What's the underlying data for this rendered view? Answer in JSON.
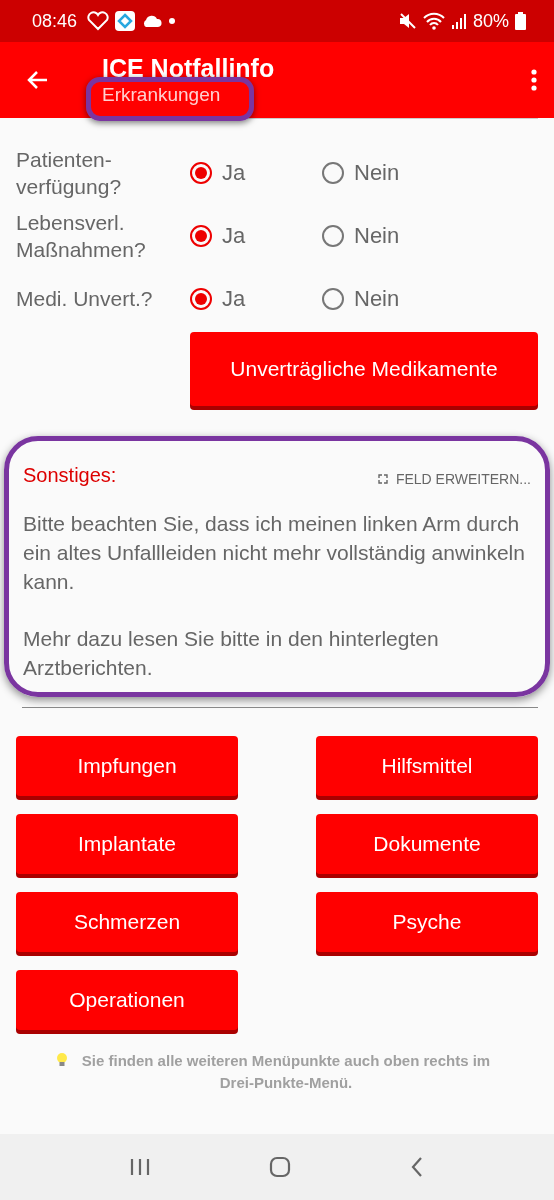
{
  "status_bar": {
    "time": "08:46",
    "battery": "80%"
  },
  "app_bar": {
    "title": "ICE Notfallinfo",
    "subtitle": "Erkrankungen"
  },
  "questions": [
    {
      "label": "Patienten-\nverfügung?",
      "options": [
        {
          "label": "Ja",
          "selected": true
        },
        {
          "label": "Nein",
          "selected": false
        }
      ]
    },
    {
      "label": "Lebensverl.\nMaßnahmen?",
      "options": [
        {
          "label": "Ja",
          "selected": true
        },
        {
          "label": "Nein",
          "selected": false
        }
      ]
    },
    {
      "label": "Medi. Unvert.?",
      "options": [
        {
          "label": "Ja",
          "selected": true
        },
        {
          "label": "Nein",
          "selected": false
        }
      ]
    }
  ],
  "medication_button": "Unverträgliche Medikamente",
  "notes": {
    "label": "Sonstiges:",
    "expand": "FELD ERWEITERN...",
    "paragraphs": [
      "Bitte beachten Sie, dass ich meinen linken Arm durch ein altes Unfallleiden nicht mehr vollständig anwinkeln kann.",
      "Mehr dazu lesen Sie bitte in den hinterlegten Arztberichten."
    ]
  },
  "menu_buttons": [
    "Impfungen",
    "Hilfsmittel",
    "Implantate",
    "Dokumente",
    "Schmerzen",
    "Psyche",
    "Operationen"
  ],
  "hint": "Sie finden alle weiteren Menüpunkte auch oben rechts im Drei-Punkte-Menü."
}
